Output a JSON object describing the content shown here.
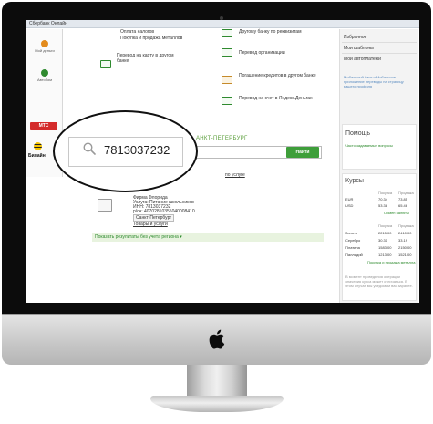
{
  "window": {
    "tab_title": "Сбербанк Онлайн"
  },
  "left_providers": [
    {
      "label": "Мой деньги",
      "color": "#e38b1c"
    },
    {
      "label": "Автобом",
      "color": "#2f8a2f"
    },
    {
      "label": "МТС",
      "color": "#d42b2b"
    },
    {
      "label": "Билайн",
      "color": "#f6c400"
    }
  ],
  "payments": {
    "top_links": [
      "Оплата налогов",
      "Покупка и продажа металлов"
    ],
    "card_transfer": "Перевод на карту в другом банке",
    "requisites_transfer": "Другому банку по реквизитам",
    "org_transfer": "Перевод организации",
    "credit_repayment": "Погашение кредитов в другом банке",
    "yandex_transfer": "Перевод на счет в Яндекс.Деньгах"
  },
  "search": {
    "region_title": "АНКТ-ПЕТЕРБУРГ",
    "button_label": "Найти",
    "query": "7813037232",
    "by_service": "по услуге"
  },
  "result": {
    "name": "Фирма Флорида",
    "service_line": "Услуга: Питание школьников",
    "inn": "ИНН: 7813037232",
    "account": "р/сч: 40702810355040008410",
    "city": "Санкт-Петербург",
    "goods_link": "Товары и услуги"
  },
  "results_footer": "Показать результаты без учета региона",
  "sidebar": {
    "items": [
      "Избранное",
      "Мои шаблоны",
      "Мои автоплатежи"
    ],
    "promo_text": "Мобильный банк и Мобильное приложение переводы на страницу вашего профиля",
    "help_title": "Помощь",
    "help_link": "Часто задаваемые вопросы",
    "rates_title": "Курсы",
    "rates_header": [
      "Покупка",
      "Продажа"
    ],
    "currencies": [
      {
        "code": "EUR",
        "buy": "70.34",
        "sell": "73.85"
      },
      {
        "code": "USD",
        "buy": "53.38",
        "sell": "65.46"
      }
    ],
    "exchange_link": "Обмен валюты",
    "metals_header": [
      "Покупка",
      "Продажа"
    ],
    "metals": [
      {
        "name": "Золото",
        "buy": "2215.00",
        "sell": "2410.00"
      },
      {
        "name": "Серебро",
        "buy": "30.31",
        "sell": "33.19"
      },
      {
        "name": "Платина",
        "buy": "1583.00",
        "sell": "2150.00"
      },
      {
        "name": "Палладий",
        "buy": "1213.00",
        "sell": "1521.00"
      }
    ],
    "metals_link": "Покупка и продажа металла",
    "disclaimer": "В момент проведения операции значения курса может отличаться. В этом случае мы уведомим вас заранее."
  }
}
